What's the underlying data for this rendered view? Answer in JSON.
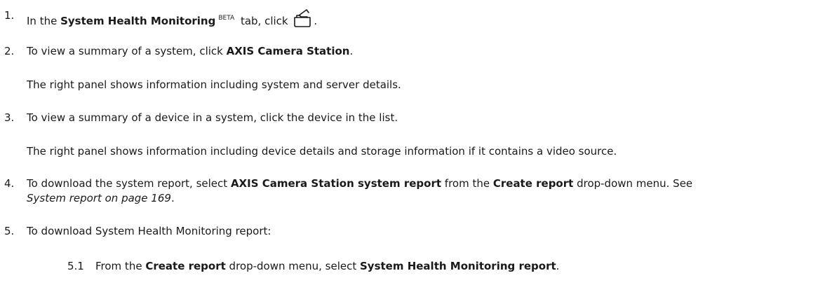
{
  "steps": [
    {
      "num": "1.",
      "a": "In the ",
      "b1": "System Health Monitoring",
      "sup": "BETA",
      "c": " tab, click ",
      "d": "."
    },
    {
      "num": "2.",
      "a": "To view a summary of a system, click ",
      "b1": "AXIS Camera Station",
      "c": ".",
      "para": "The right panel shows information including system and server details."
    },
    {
      "num": "3.",
      "a": "To view a summary of a device in a system, click the device in the list.",
      "para": "The right panel shows information including device details and storage information if it contains a video source."
    },
    {
      "num": "4.",
      "a": "To download the system report, select ",
      "b1": "AXIS Camera Station system report",
      "c": " from the ",
      "b2": "Create report",
      "d": " drop-down menu. See",
      "line2_link": "System report on page 169",
      "line2_end": "."
    },
    {
      "num": "5.",
      "a": "To download System Health Monitoring report:"
    }
  ],
  "substeps": [
    {
      "num": "5.1",
      "a": "From the ",
      "b1": "Create report",
      "c": " drop-down menu, select ",
      "b2": "System Health Monitoring report",
      "d": "."
    }
  ],
  "icons": {
    "step1_icon": "open-folder-icon"
  }
}
